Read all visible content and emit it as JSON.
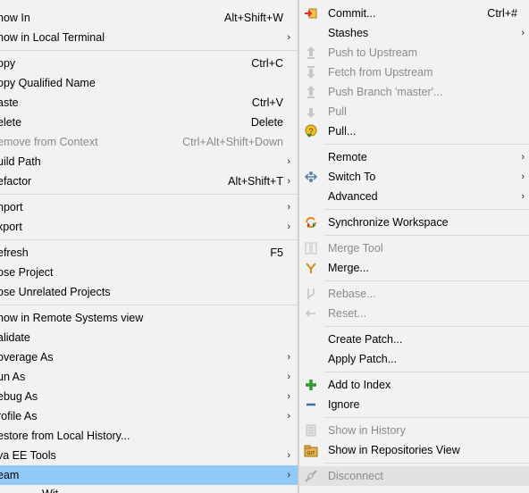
{
  "left_menu": {
    "items": [
      {
        "label": "how In",
        "accel": "Alt+Shift+W",
        "arrow": "›"
      },
      {
        "label": "how in Local Terminal",
        "arrow": "›"
      },
      {
        "label": "opy",
        "accel": "Ctrl+C"
      },
      {
        "label": "opy Qualified Name"
      },
      {
        "label": "aste",
        "accel": "Ctrl+V"
      },
      {
        "label": "elete",
        "accel": "Delete"
      },
      {
        "label": "emove from Context",
        "accel": "Ctrl+Alt+Shift+Down"
      },
      {
        "label": "uild Path",
        "arrow": "›"
      },
      {
        "label": "efactor",
        "accel": "Alt+Shift+T",
        "arrow": "›"
      },
      {
        "label": "nport",
        "arrow": "›"
      },
      {
        "label": "xport",
        "arrow": "›"
      },
      {
        "label": "efresh",
        "accel": "F5"
      },
      {
        "label": "ose Project"
      },
      {
        "label": "ose Unrelated Projects"
      },
      {
        "label": "how in Remote Systems view"
      },
      {
        "label": "alidate"
      },
      {
        "label": "overage As",
        "arrow": "›"
      },
      {
        "label": "un As",
        "arrow": "›"
      },
      {
        "label": "ebug As",
        "arrow": "›"
      },
      {
        "label": "rofile As",
        "arrow": "›"
      },
      {
        "label": "estore from Local History..."
      },
      {
        "label": "va EE Tools",
        "arrow": "›"
      },
      {
        "label": "eam",
        "arrow": "›"
      },
      {
        "label": "Wit"
      }
    ]
  },
  "right_menu": {
    "items": [
      {
        "label": "Commit...",
        "accel": "Ctrl+#",
        "icon": "commit-icon"
      },
      {
        "label": "Stashes",
        "arrow": "›"
      },
      {
        "label": "Push to Upstream",
        "icon": "push-upstream-icon"
      },
      {
        "label": "Fetch from Upstream",
        "icon": "fetch-upstream-icon"
      },
      {
        "label": "Push Branch 'master'...",
        "icon": "push-branch-icon"
      },
      {
        "label": "Pull",
        "icon": "pull-icon"
      },
      {
        "label": "Pull...",
        "icon": "pull-dialog-icon"
      },
      {
        "label": "Remote",
        "arrow": "›"
      },
      {
        "label": "Switch To",
        "arrow": "›",
        "icon": "switch-branch-icon"
      },
      {
        "label": "Advanced",
        "arrow": "›"
      },
      {
        "label": "Synchronize Workspace",
        "icon": "synchronize-icon"
      },
      {
        "label": "Merge Tool",
        "icon": "merge-tool-icon"
      },
      {
        "label": "Merge...",
        "icon": "merge-icon"
      },
      {
        "label": "Rebase...",
        "icon": "rebase-icon"
      },
      {
        "label": "Reset...",
        "icon": "reset-icon"
      },
      {
        "label": "Create Patch..."
      },
      {
        "label": "Apply Patch..."
      },
      {
        "label": "Add to Index",
        "icon": "add-to-index-icon"
      },
      {
        "label": "Ignore",
        "icon": "ignore-icon"
      },
      {
        "label": "Show in History",
        "icon": "history-icon"
      },
      {
        "label": "Show in Repositories View",
        "icon": "repositories-icon"
      },
      {
        "label": "Disconnect",
        "icon": "disconnect-icon"
      }
    ]
  },
  "colors": {
    "highlight": "#91c9f7",
    "disabled_text": "#8a8a8a",
    "menu_bg": "#f2f2f2"
  }
}
